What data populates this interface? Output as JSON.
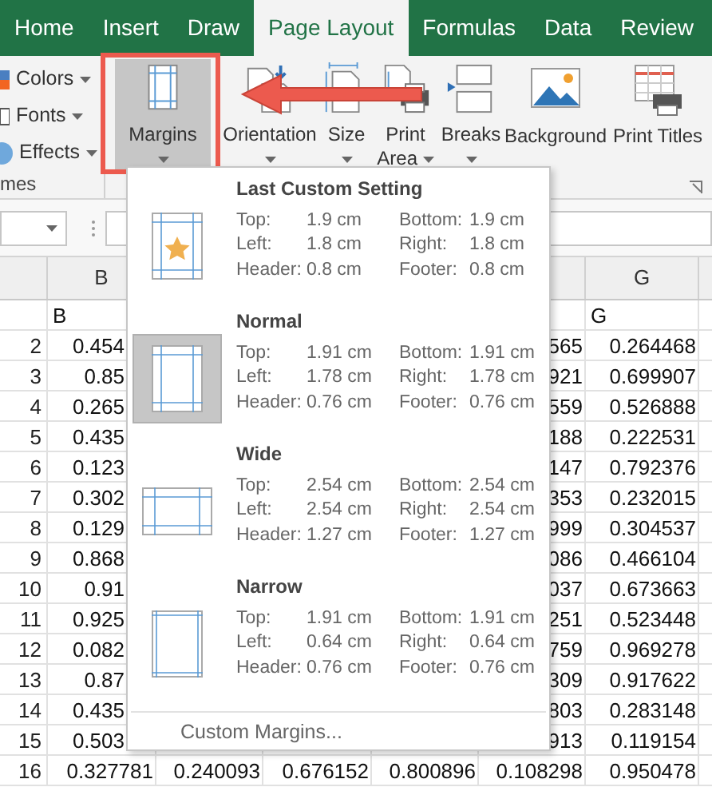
{
  "tabs": [
    {
      "label": "Home",
      "selected": false
    },
    {
      "label": "Insert",
      "selected": false
    },
    {
      "label": "Draw",
      "selected": false
    },
    {
      "label": "Page Layout",
      "selected": true
    },
    {
      "label": "Formulas",
      "selected": false
    },
    {
      "label": "Data",
      "selected": false
    },
    {
      "label": "Review",
      "selected": false
    }
  ],
  "ribbon": {
    "theme_group": {
      "label": "mes",
      "items": [
        {
          "label": "Colors"
        },
        {
          "label": "Fonts"
        },
        {
          "label": "Effects"
        }
      ]
    },
    "buttons": [
      {
        "label": "Margins",
        "menu": true,
        "selected": true
      },
      {
        "label": "Orientation",
        "menu": true,
        "selected": false
      },
      {
        "label": "Size",
        "menu": true,
        "selected": false
      },
      {
        "label": "Print Area",
        "menu": true,
        "selected": false
      },
      {
        "label": "Breaks",
        "menu": true,
        "selected": false
      },
      {
        "label": "Background",
        "menu": false,
        "selected": false
      },
      {
        "label": "Print Titles",
        "menu": false,
        "selected": false
      }
    ]
  },
  "sheet": {
    "column_headers": [
      {
        "label": "B"
      },
      {
        "label": "G"
      }
    ],
    "rows": [
      {
        "kind": "labels",
        "cells": [
          "B",
          "G"
        ]
      },
      {
        "kind": "covered",
        "number": "2",
        "cells": [
          "0.454",
          "565",
          "0.264468"
        ]
      },
      {
        "kind": "covered",
        "number": "3",
        "cells": [
          "0.85",
          "921",
          "0.699907"
        ]
      },
      {
        "kind": "covered",
        "number": "4",
        "cells": [
          "0.265",
          "559",
          "0.526888"
        ]
      },
      {
        "kind": "covered",
        "number": "5",
        "cells": [
          "0.435",
          "188",
          "0.222531"
        ]
      },
      {
        "kind": "covered",
        "number": "6",
        "cells": [
          "0.123",
          "147",
          "0.792376"
        ]
      },
      {
        "kind": "covered",
        "number": "7",
        "cells": [
          "0.302",
          "353",
          "0.232015"
        ]
      },
      {
        "kind": "covered",
        "number": "8",
        "cells": [
          "0.129",
          "999",
          "0.304537"
        ]
      },
      {
        "kind": "covered",
        "number": "9",
        "cells": [
          "0.868",
          "086",
          "0.466104"
        ]
      },
      {
        "kind": "covered",
        "number": "10",
        "cells": [
          "0.91",
          "037",
          "0.673663"
        ]
      },
      {
        "kind": "covered",
        "number": "11",
        "cells": [
          "0.925",
          "251",
          "0.523448"
        ]
      },
      {
        "kind": "covered",
        "number": "12",
        "cells": [
          "0.082",
          "759",
          "0.969278"
        ]
      },
      {
        "kind": "covered",
        "number": "13",
        "cells": [
          "0.87",
          "309",
          "0.917622"
        ]
      },
      {
        "kind": "covered",
        "number": "14",
        "cells": [
          "0.435",
          "803",
          "0.283148"
        ]
      },
      {
        "kind": "covered",
        "number": "15",
        "cells": [
          "0.503",
          "913",
          "0.119154"
        ]
      },
      {
        "kind": "full",
        "number": "16",
        "cells": [
          "0.327781",
          "0.240093",
          "0.676152",
          "0.800896",
          "0.108298",
          "0.950478"
        ]
      }
    ]
  },
  "margins_menu": {
    "items": [
      {
        "name": "Last Custom Setting",
        "kind": "custom",
        "selected": false,
        "fields": [
          {
            "label": "Top:",
            "value": "1.9 cm"
          },
          {
            "label": "Bottom:",
            "value": "1.9 cm"
          },
          {
            "label": "Left:",
            "value": "1.8 cm"
          },
          {
            "label": "Right:",
            "value": "1.8 cm"
          },
          {
            "label": "Header:",
            "value": "0.8 cm"
          },
          {
            "label": "Footer:",
            "value": "0.8 cm"
          }
        ]
      },
      {
        "name": "Normal",
        "kind": "normal",
        "selected": true,
        "fields": [
          {
            "label": "Top:",
            "value": "1.91 cm"
          },
          {
            "label": "Bottom:",
            "value": "1.91 cm"
          },
          {
            "label": "Left:",
            "value": "1.78 cm"
          },
          {
            "label": "Right:",
            "value": "1.78 cm"
          },
          {
            "label": "Header:",
            "value": "0.76 cm"
          },
          {
            "label": "Footer:",
            "value": "0.76 cm"
          }
        ]
      },
      {
        "name": "Wide",
        "kind": "wide",
        "selected": false,
        "fields": [
          {
            "label": "Top:",
            "value": "2.54 cm"
          },
          {
            "label": "Bottom:",
            "value": "2.54 cm"
          },
          {
            "label": "Left:",
            "value": "2.54 cm"
          },
          {
            "label": "Right:",
            "value": "2.54 cm"
          },
          {
            "label": "Header:",
            "value": "1.27 cm"
          },
          {
            "label": "Footer:",
            "value": "1.27 cm"
          }
        ]
      },
      {
        "name": "Narrow",
        "kind": "narrow",
        "selected": false,
        "fields": [
          {
            "label": "Top:",
            "value": "1.91 cm"
          },
          {
            "label": "Bottom:",
            "value": "1.91 cm"
          },
          {
            "label": "Left:",
            "value": "0.64 cm"
          },
          {
            "label": "Right:",
            "value": "0.64 cm"
          },
          {
            "label": "Header:",
            "value": "0.76 cm"
          },
          {
            "label": "Footer:",
            "value": "0.76 cm"
          }
        ]
      }
    ],
    "footer": "Custom Margins..."
  }
}
